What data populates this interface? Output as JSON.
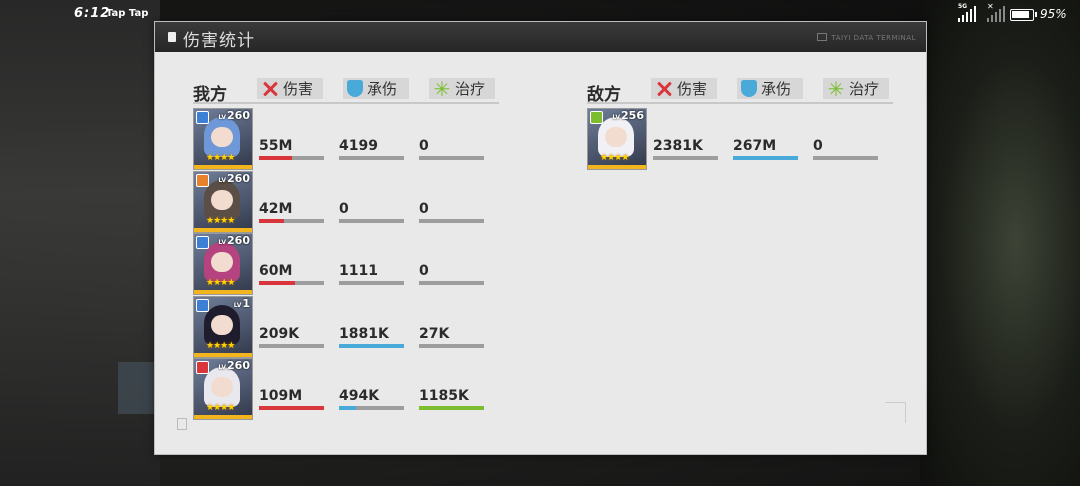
{
  "status_bar": {
    "time": "6:12",
    "app": "Tap Tap",
    "network": "5G",
    "battery": "95%",
    "battery_level": 0.95
  },
  "panel": {
    "title": "伤害统计",
    "terminal_label": "TAIYI DATA TERMINAL"
  },
  "headers": {
    "damage": "伤害",
    "tank": "承伤",
    "heal": "治疗"
  },
  "colors": {
    "damage": "#d9363c",
    "tank": "#49a9d9",
    "heal": "#7bbd2e"
  },
  "allies": {
    "title": "我方",
    "members": [
      {
        "level": "260",
        "level_prefix": "LV",
        "badge_color": "#3e7fd6",
        "hair": "#6f98d8",
        "damage": "55M",
        "tank": "4199",
        "heal": "0",
        "damage_fill": 0.5,
        "tank_fill": 0,
        "heal_fill": 0
      },
      {
        "level": "260",
        "level_prefix": "LV",
        "badge_color": "#e6822b",
        "hair": "#5a4e46",
        "damage": "42M",
        "tank": "0",
        "heal": "0",
        "damage_fill": 0.38,
        "tank_fill": 0,
        "heal_fill": 0
      },
      {
        "level": "260",
        "level_prefix": "LV",
        "badge_color": "#3e7fd6",
        "hair": "#b4437f",
        "damage": "60M",
        "tank": "1111",
        "heal": "0",
        "damage_fill": 0.55,
        "tank_fill": 0,
        "heal_fill": 0
      },
      {
        "level": "1",
        "level_prefix": "LV",
        "badge_color": "#3e7fd6",
        "hair": "#1f1d2d",
        "damage": "209K",
        "tank": "1881K",
        "heal": "27K",
        "damage_fill": 0,
        "tank_fill": 1.0,
        "heal_fill": 0
      },
      {
        "level": "260",
        "level_prefix": "LV",
        "badge_color": "#d9363c",
        "hair": "#e8e8ee",
        "damage": "109M",
        "tank": "494K",
        "heal": "1185K",
        "damage_fill": 1.0,
        "tank_fill": 0.26,
        "heal_fill": 1.0
      }
    ]
  },
  "enemies": {
    "title": "敌方",
    "members": [
      {
        "level": "256",
        "level_prefix": "LV",
        "badge_color": "#7bbd2e",
        "hair": "#f0f0f5",
        "damage": "2381K",
        "tank": "267M",
        "heal": "0",
        "damage_fill": 0,
        "tank_fill": 1.0,
        "heal_fill": 0
      }
    ]
  }
}
